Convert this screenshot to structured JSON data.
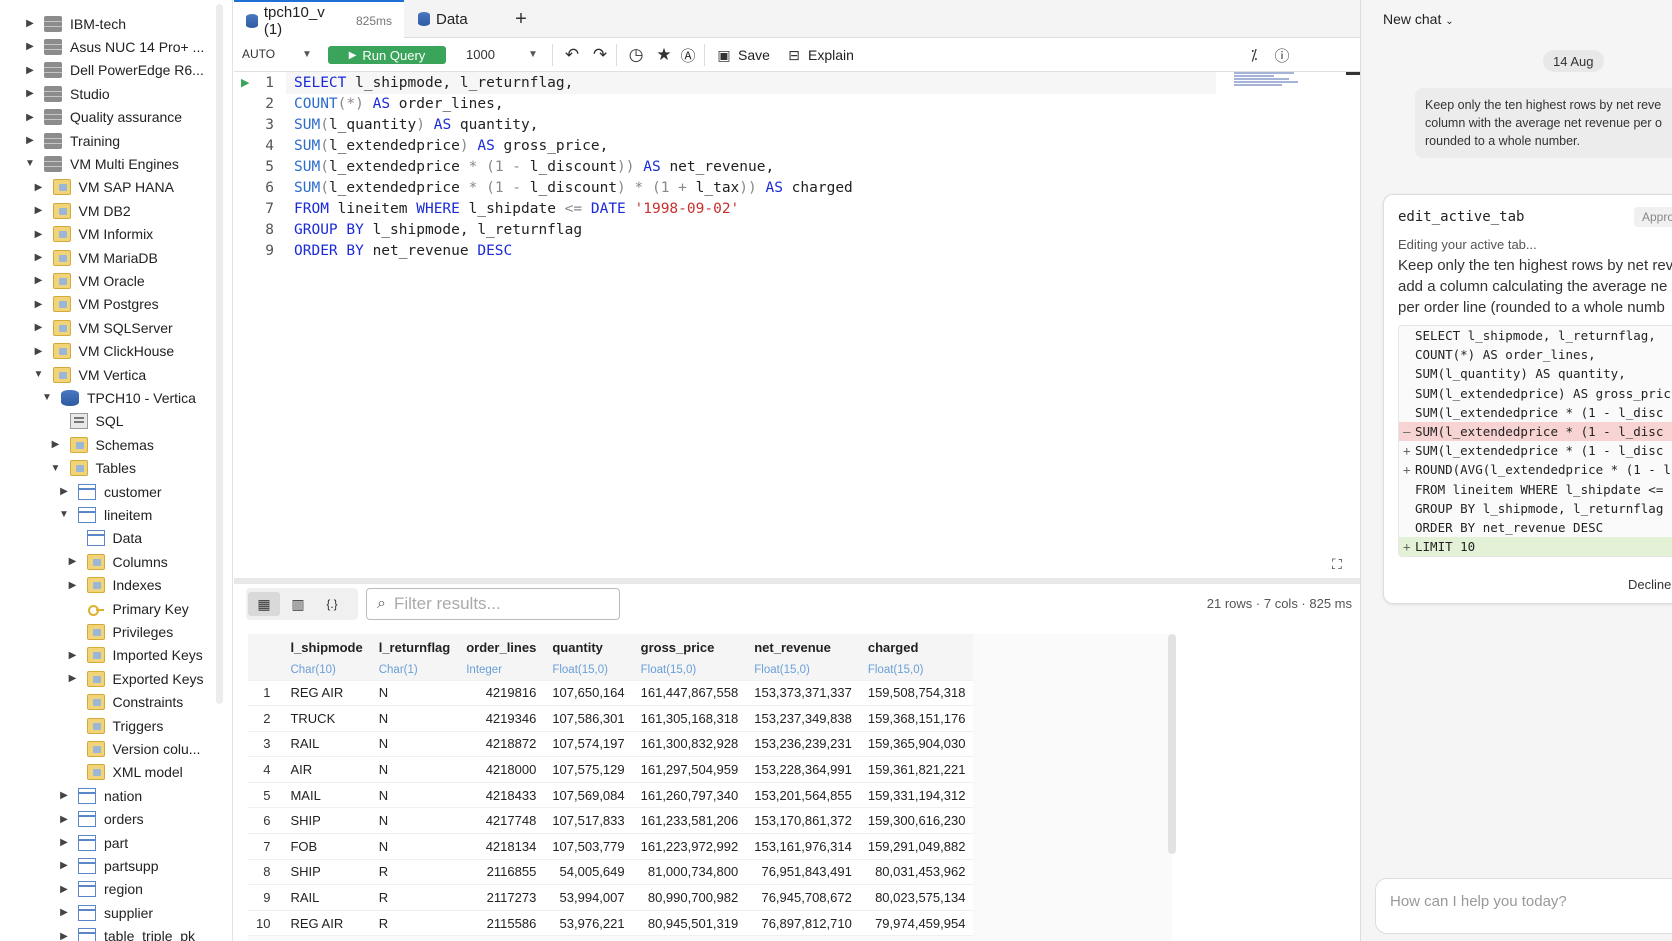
{
  "sidebar": {
    "items": [
      {
        "label": "IBM-tech",
        "icon": "server-icon"
      },
      {
        "label": "Asus NUC 14 Pro+ ...",
        "icon": "server-icon"
      },
      {
        "label": "Dell PowerEdge R6...",
        "icon": "server-icon"
      },
      {
        "label": "Studio",
        "icon": "server-icon"
      },
      {
        "label": "Quality assurance",
        "icon": "server-icon"
      },
      {
        "label": "Training",
        "icon": "server-icon"
      },
      {
        "label": "VM Multi Engines",
        "icon": "server-icon"
      },
      {
        "label": "VM SAP HANA",
        "icon": "folder-icon"
      },
      {
        "label": "VM DB2",
        "icon": "folder-icon"
      },
      {
        "label": "VM Informix",
        "icon": "folder-icon"
      },
      {
        "label": "VM MariaDB",
        "icon": "folder-icon"
      },
      {
        "label": "VM Oracle",
        "icon": "folder-icon"
      },
      {
        "label": "VM Postgres",
        "icon": "folder-icon"
      },
      {
        "label": "VM SQLServer",
        "icon": "folder-icon"
      },
      {
        "label": "VM ClickHouse",
        "icon": "folder-icon"
      },
      {
        "label": "VM Vertica",
        "icon": "folder-icon"
      },
      {
        "label": "TPCH10 - Vertica",
        "icon": "database-icon"
      },
      {
        "label": "SQL",
        "icon": "sql-icon"
      },
      {
        "label": "Schemas",
        "icon": "folder-icon"
      },
      {
        "label": "Tables",
        "icon": "folder-icon"
      },
      {
        "label": "customer",
        "icon": "table-icon"
      },
      {
        "label": "lineitem",
        "icon": "table-icon"
      },
      {
        "label": "Data",
        "icon": "table-icon"
      },
      {
        "label": "Columns",
        "icon": "folder-icon"
      },
      {
        "label": "Indexes",
        "icon": "folder-icon"
      },
      {
        "label": "Primary Key",
        "icon": "key-icon"
      },
      {
        "label": "Privileges",
        "icon": "folder-icon"
      },
      {
        "label": "Imported Keys",
        "icon": "folder-icon"
      },
      {
        "label": "Exported Keys",
        "icon": "folder-icon"
      },
      {
        "label": "Constraints",
        "icon": "folder-icon"
      },
      {
        "label": "Triggers",
        "icon": "folder-icon"
      },
      {
        "label": "Version colu...",
        "icon": "folder-icon"
      },
      {
        "label": "XML model",
        "icon": "folder-icon"
      },
      {
        "label": "nation",
        "icon": "table-icon"
      },
      {
        "label": "orders",
        "icon": "table-icon"
      },
      {
        "label": "part",
        "icon": "table-icon"
      },
      {
        "label": "partsupp",
        "icon": "table-icon"
      },
      {
        "label": "region",
        "icon": "table-icon"
      },
      {
        "label": "supplier",
        "icon": "table-icon"
      },
      {
        "label": "table_triple_pk",
        "icon": "table-icon"
      }
    ]
  },
  "tabs": [
    {
      "label": "tpch10_v (1)",
      "time": "825ms"
    },
    {
      "label": "Data",
      "time": ""
    }
  ],
  "toolbar": {
    "mode": "AUTO",
    "run_label": "Run Query",
    "limit": "1000",
    "save_label": "Save",
    "explain_label": "Explain"
  },
  "editor": {
    "lines": [
      [
        [
          "kw",
          "SELECT"
        ],
        [
          "txt",
          " l_shipmode, l_returnflag,"
        ]
      ],
      [
        [
          "fn",
          "COUNT"
        ],
        [
          "op",
          "(*)"
        ],
        [
          "txt",
          " "
        ],
        [
          "kw",
          "AS"
        ],
        [
          "txt",
          " order_lines,"
        ]
      ],
      [
        [
          "fn",
          "SUM"
        ],
        [
          "op",
          "("
        ],
        [
          "txt",
          "l_quantity"
        ],
        [
          "op",
          ")"
        ],
        [
          "txt",
          " "
        ],
        [
          "kw",
          "AS"
        ],
        [
          "txt",
          " quantity,"
        ]
      ],
      [
        [
          "fn",
          "SUM"
        ],
        [
          "op",
          "("
        ],
        [
          "txt",
          "l_extendedprice"
        ],
        [
          "op",
          ")"
        ],
        [
          "txt",
          " "
        ],
        [
          "kw",
          "AS"
        ],
        [
          "txt",
          " gross_price,"
        ]
      ],
      [
        [
          "fn",
          "SUM"
        ],
        [
          "op",
          "("
        ],
        [
          "txt",
          "l_extendedprice "
        ],
        [
          "op",
          "* (1 - "
        ],
        [
          "txt",
          "l_discount"
        ],
        [
          "op",
          "))"
        ],
        [
          "txt",
          " "
        ],
        [
          "kw",
          "AS"
        ],
        [
          "txt",
          " net_revenue,"
        ]
      ],
      [
        [
          "fn",
          "SUM"
        ],
        [
          "op",
          "("
        ],
        [
          "txt",
          "l_extendedprice "
        ],
        [
          "op",
          "* (1 - "
        ],
        [
          "txt",
          "l_discount"
        ],
        [
          "op",
          ") * (1 + "
        ],
        [
          "txt",
          "l_tax"
        ],
        [
          "op",
          "))"
        ],
        [
          "txt",
          " "
        ],
        [
          "kw",
          "AS"
        ],
        [
          "txt",
          " charged"
        ]
      ],
      [
        [
          "kw",
          "FROM"
        ],
        [
          "txt",
          " lineitem "
        ],
        [
          "kw",
          "WHERE"
        ],
        [
          "txt",
          " l_shipdate "
        ],
        [
          "op",
          "<="
        ],
        [
          "txt",
          " "
        ],
        [
          "kw",
          "DATE"
        ],
        [
          "txt",
          " "
        ],
        [
          "str",
          "'1998-09-02'"
        ]
      ],
      [
        [
          "kw",
          "GROUP BY"
        ],
        [
          "txt",
          " l_shipmode, l_returnflag"
        ]
      ],
      [
        [
          "kw",
          "ORDER BY"
        ],
        [
          "txt",
          " net_revenue "
        ],
        [
          "kw",
          "DESC"
        ]
      ]
    ]
  },
  "results": {
    "filter_placeholder": "Filter results...",
    "stats": "21 rows · 7 cols · 825 ms",
    "columns": [
      {
        "name": "l_shipmode",
        "type": "Char(10)"
      },
      {
        "name": "l_returnflag",
        "type": "Char(1)"
      },
      {
        "name": "order_lines",
        "type": "Integer"
      },
      {
        "name": "quantity",
        "type": "Float(15,0)"
      },
      {
        "name": "gross_price",
        "type": "Float(15,0)"
      },
      {
        "name": "net_revenue",
        "type": "Float(15,0)"
      },
      {
        "name": "charged",
        "type": "Float(15,0)"
      }
    ],
    "rows": [
      [
        "1",
        "REG AIR",
        "N",
        "4219816",
        "107,650,164",
        "161,447,867,558",
        "153,373,371,337",
        "159,508,754,318"
      ],
      [
        "2",
        "TRUCK",
        "N",
        "4219346",
        "107,586,301",
        "161,305,168,318",
        "153,237,349,838",
        "159,368,151,176"
      ],
      [
        "3",
        "RAIL",
        "N",
        "4218872",
        "107,574,197",
        "161,300,832,928",
        "153,236,239,231",
        "159,365,904,030"
      ],
      [
        "4",
        "AIR",
        "N",
        "4218000",
        "107,575,129",
        "161,297,504,959",
        "153,228,364,991",
        "159,361,821,221"
      ],
      [
        "5",
        "MAIL",
        "N",
        "4218433",
        "107,569,084",
        "161,260,797,340",
        "153,201,564,855",
        "159,331,194,312"
      ],
      [
        "6",
        "SHIP",
        "N",
        "4217748",
        "107,517,833",
        "161,233,581,206",
        "153,170,861,372",
        "159,300,616,230"
      ],
      [
        "7",
        "FOB",
        "N",
        "4218134",
        "107,503,779",
        "161,223,972,992",
        "153,161,976,314",
        "159,291,049,882"
      ],
      [
        "8",
        "SHIP",
        "R",
        "2116855",
        "54,005,649",
        "81,000,734,800",
        "76,951,843,491",
        "80,031,453,962"
      ],
      [
        "9",
        "RAIL",
        "R",
        "2117273",
        "53,994,007",
        "80,990,700,982",
        "76,945,708,672",
        "80,023,575,134"
      ],
      [
        "10",
        "REG AIR",
        "R",
        "2115586",
        "53,976,221",
        "80,945,501,319",
        "76,897,812,710",
        "79,974,459,954"
      ]
    ]
  },
  "chat": {
    "title": "New chat",
    "date": "14 Aug",
    "user_message": [
      "Keep only the ten highest rows by net reve",
      "column with the average net revenue per o",
      "rounded to a whole number."
    ],
    "tool_name": "edit_active_tab",
    "tool_badge": "Appro",
    "tool_status": "Editing your active tab...",
    "tool_desc": [
      "Keep only the ten highest rows by net rev",
      "add a column calculating the average ne",
      "per order line (rounded to a whole numb"
    ],
    "diff": [
      {
        "mark": "",
        "type": "ctx",
        "text": "SELECT l_shipmode, l_returnflag,"
      },
      {
        "mark": "",
        "type": "ctx",
        "text": "COUNT(*) AS order_lines,"
      },
      {
        "mark": "",
        "type": "ctx",
        "text": "SUM(l_quantity) AS quantity,"
      },
      {
        "mark": "",
        "type": "ctx",
        "text": "SUM(l_extendedprice) AS gross_pric"
      },
      {
        "mark": "",
        "type": "ctx",
        "text": "SUM(l_extendedprice * (1 - l_disc"
      },
      {
        "mark": "—",
        "type": "del",
        "text": "SUM(l_extendedprice * (1 - l_disc"
      },
      {
        "mark": "+",
        "type": "ctx",
        "text": "SUM(l_extendedprice * (1 - l_disc"
      },
      {
        "mark": "+",
        "type": "ctx",
        "text": "ROUND(AVG(l_extendedprice * (1 - l"
      },
      {
        "mark": "",
        "type": "ctx",
        "text": "FROM lineitem WHERE l_shipdate <="
      },
      {
        "mark": "",
        "type": "ctx",
        "text": "GROUP BY l_shipmode, l_returnflag"
      },
      {
        "mark": "",
        "type": "ctx",
        "text": "ORDER BY net_revenue DESC"
      },
      {
        "mark": "+",
        "type": "add",
        "text": "LIMIT 10"
      }
    ],
    "decline_label": "Decline",
    "input_placeholder": "How can I help you today?"
  }
}
